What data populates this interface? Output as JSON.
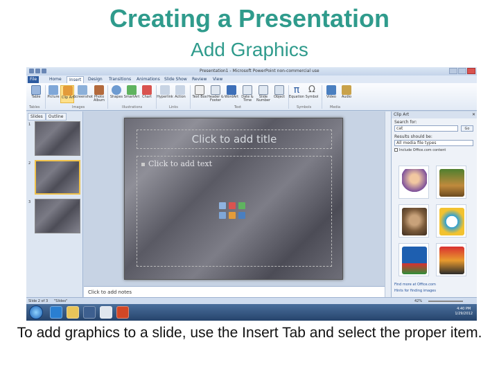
{
  "page": {
    "title": "Creating a Presentation",
    "subtitle": "Add Graphics",
    "caption": "To add graphics to a slide, use the Insert Tab and select the proper item."
  },
  "colors": {
    "heading": "#2f9b8c",
    "ribbon_highlight": "#fde08a",
    "file_tab": "#2c5aa0"
  },
  "app": {
    "window_title": "Presentation1 - Microsoft PowerPoint non-commercial use",
    "tabs": [
      "File",
      "Home",
      "Insert",
      "Design",
      "Transitions",
      "Animations",
      "Slide Show",
      "Review",
      "View"
    ],
    "active_tab": "Insert",
    "ribbon": {
      "buttons": [
        "Table",
        "Picture",
        "Clip Art",
        "Screenshot",
        "Photo Album",
        "Shapes",
        "SmartArt",
        "Chart",
        "Hyperlink",
        "Action",
        "Text Box",
        "Header & Footer",
        "WordArt",
        "Date & Time",
        "Slide Number",
        "Object",
        "Equation",
        "Symbol",
        "Video",
        "Audio"
      ],
      "highlighted": "Clip Art",
      "groups": [
        "Tables",
        "Images",
        "Illustrations",
        "Links",
        "Text",
        "Symbols",
        "Media"
      ]
    },
    "left_panel": {
      "tabs": [
        "Slides",
        "Outline"
      ],
      "slide_numbers": [
        "1",
        "2",
        "3"
      ],
      "selected_slide": "2"
    },
    "slide": {
      "title_placeholder": "Click to add title",
      "content_placeholder": "Click to add text"
    },
    "notes_placeholder": "Click to add notes",
    "clip_art": {
      "header": "Clip Art",
      "search_label": "Search for:",
      "search_value": "cat",
      "go_label": "Go",
      "results_label": "Results should be:",
      "results_value": "All media file types",
      "include_office_label": "Include Office.com content",
      "links": [
        "Find more at Office.com",
        "Hints for finding images"
      ],
      "result_icons": [
        "person-clipart",
        "animal-clipart",
        "cat-photo",
        "cartoon-cat-clipart",
        "cat-flower-clipart",
        "cat-cartoon-clipart"
      ]
    },
    "status": {
      "slide_info": "Slide 2 of 3",
      "theme": "\"Slides\"",
      "zoom": "42%"
    },
    "taskbar": {
      "time": "4:40 PM",
      "date": "1/29/2012"
    }
  }
}
